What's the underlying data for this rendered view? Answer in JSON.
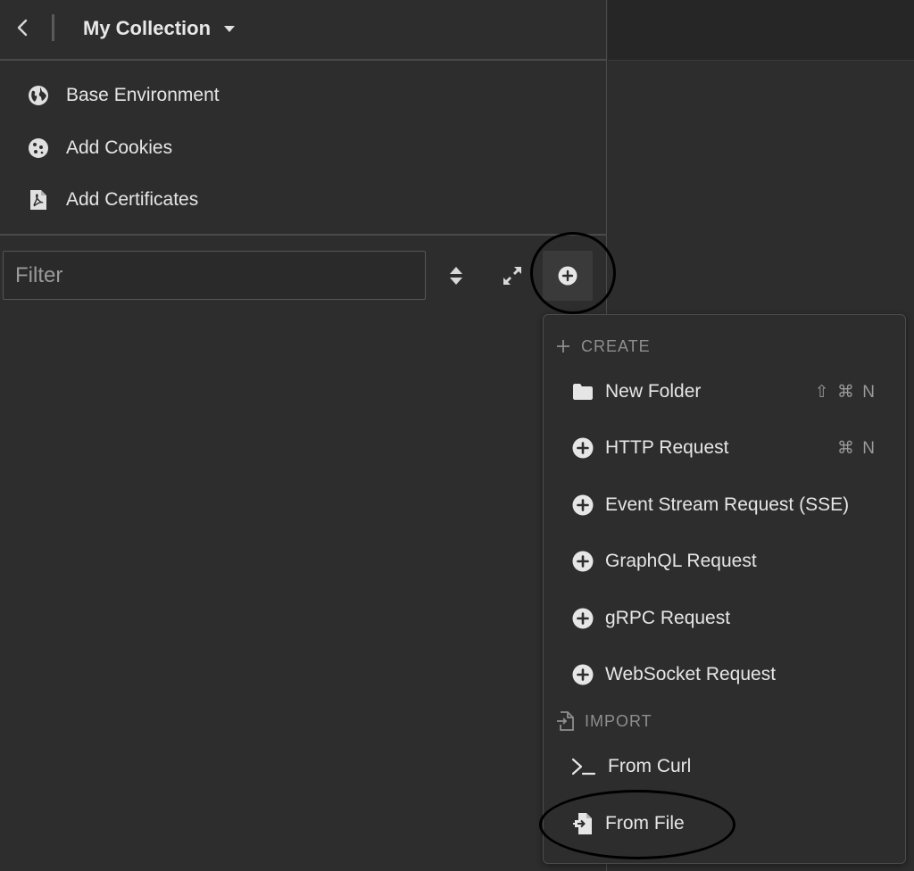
{
  "header": {
    "title": "My Collection"
  },
  "quick_links": [
    {
      "label": "Base Environment",
      "icon": "globe-icon"
    },
    {
      "label": "Add Cookies",
      "icon": "cookie-icon"
    },
    {
      "label": "Add Certificates",
      "icon": "certificate-icon"
    }
  ],
  "filter": {
    "placeholder": "Filter",
    "value": ""
  },
  "dropdown": {
    "create_header": "CREATE",
    "import_header": "IMPORT",
    "create_items": [
      {
        "label": "New Folder",
        "shortcut": "⇧ ⌘ N",
        "icon": "folder-icon"
      },
      {
        "label": "HTTP Request",
        "shortcut": "⌘ N",
        "icon": "plus-circle-icon"
      },
      {
        "label": "Event Stream Request (SSE)",
        "shortcut": "",
        "icon": "plus-circle-icon"
      },
      {
        "label": "GraphQL Request",
        "shortcut": "",
        "icon": "plus-circle-icon"
      },
      {
        "label": "gRPC Request",
        "shortcut": "",
        "icon": "plus-circle-icon"
      },
      {
        "label": "WebSocket Request",
        "shortcut": "",
        "icon": "plus-circle-icon"
      }
    ],
    "import_items": [
      {
        "label": "From Curl",
        "icon": "terminal-icon"
      },
      {
        "label": "From File",
        "icon": "file-import-icon"
      }
    ]
  },
  "colors": {
    "background": "#2d2d2d",
    "text": "#e6e6e6",
    "muted": "#8e8e8e",
    "border": "#4a4a4a"
  }
}
